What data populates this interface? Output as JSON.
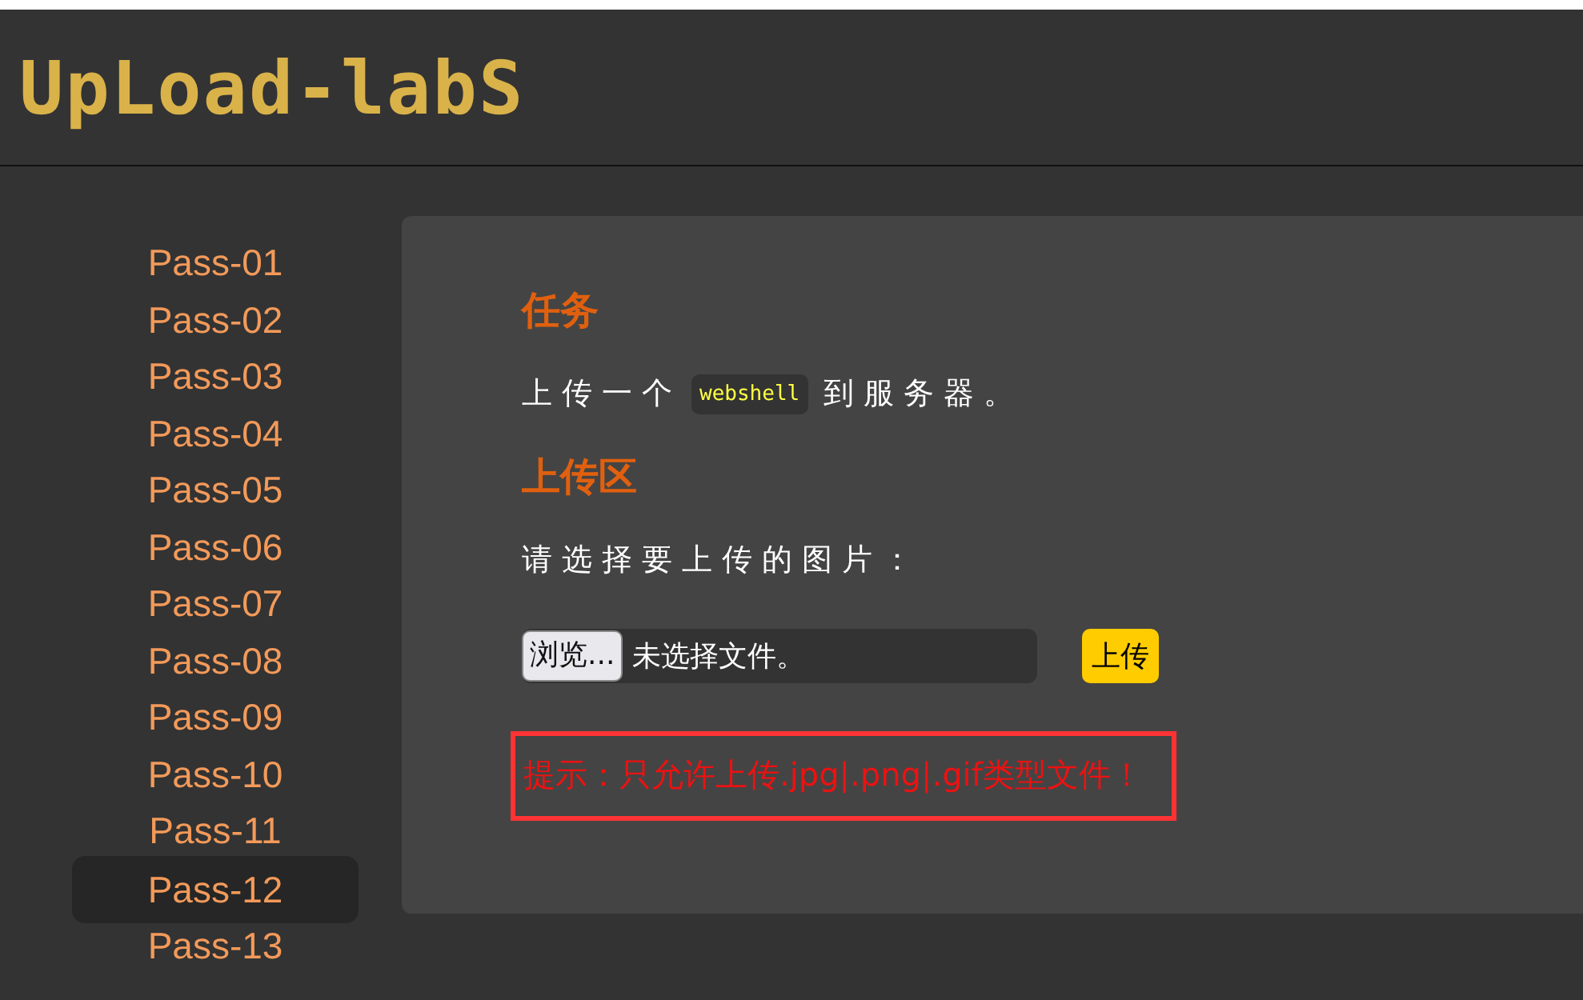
{
  "header": {
    "logo": "UpLoad-labS"
  },
  "sidebar": {
    "items": [
      {
        "label": "Pass-01",
        "selected": false
      },
      {
        "label": "Pass-02",
        "selected": false
      },
      {
        "label": "Pass-03",
        "selected": false
      },
      {
        "label": "Pass-04",
        "selected": false
      },
      {
        "label": "Pass-05",
        "selected": false
      },
      {
        "label": "Pass-06",
        "selected": false
      },
      {
        "label": "Pass-07",
        "selected": false
      },
      {
        "label": "Pass-08",
        "selected": false
      },
      {
        "label": "Pass-09",
        "selected": false
      },
      {
        "label": "Pass-10",
        "selected": false
      },
      {
        "label": "Pass-11",
        "selected": false
      },
      {
        "label": "Pass-12",
        "selected": true
      },
      {
        "label": "Pass-13",
        "selected": false
      }
    ]
  },
  "task": {
    "heading": "任务",
    "before": "上传一个",
    "code": "webshell",
    "after": "到服务器。"
  },
  "upload": {
    "heading": "上传区",
    "prompt": "请选择要上传的图片：",
    "browse_button": "浏览...",
    "file_status": "未选择文件。",
    "submit_button": "上传"
  },
  "hint": "提示：只允许上传.jpg|.png|.gif类型文件！"
}
